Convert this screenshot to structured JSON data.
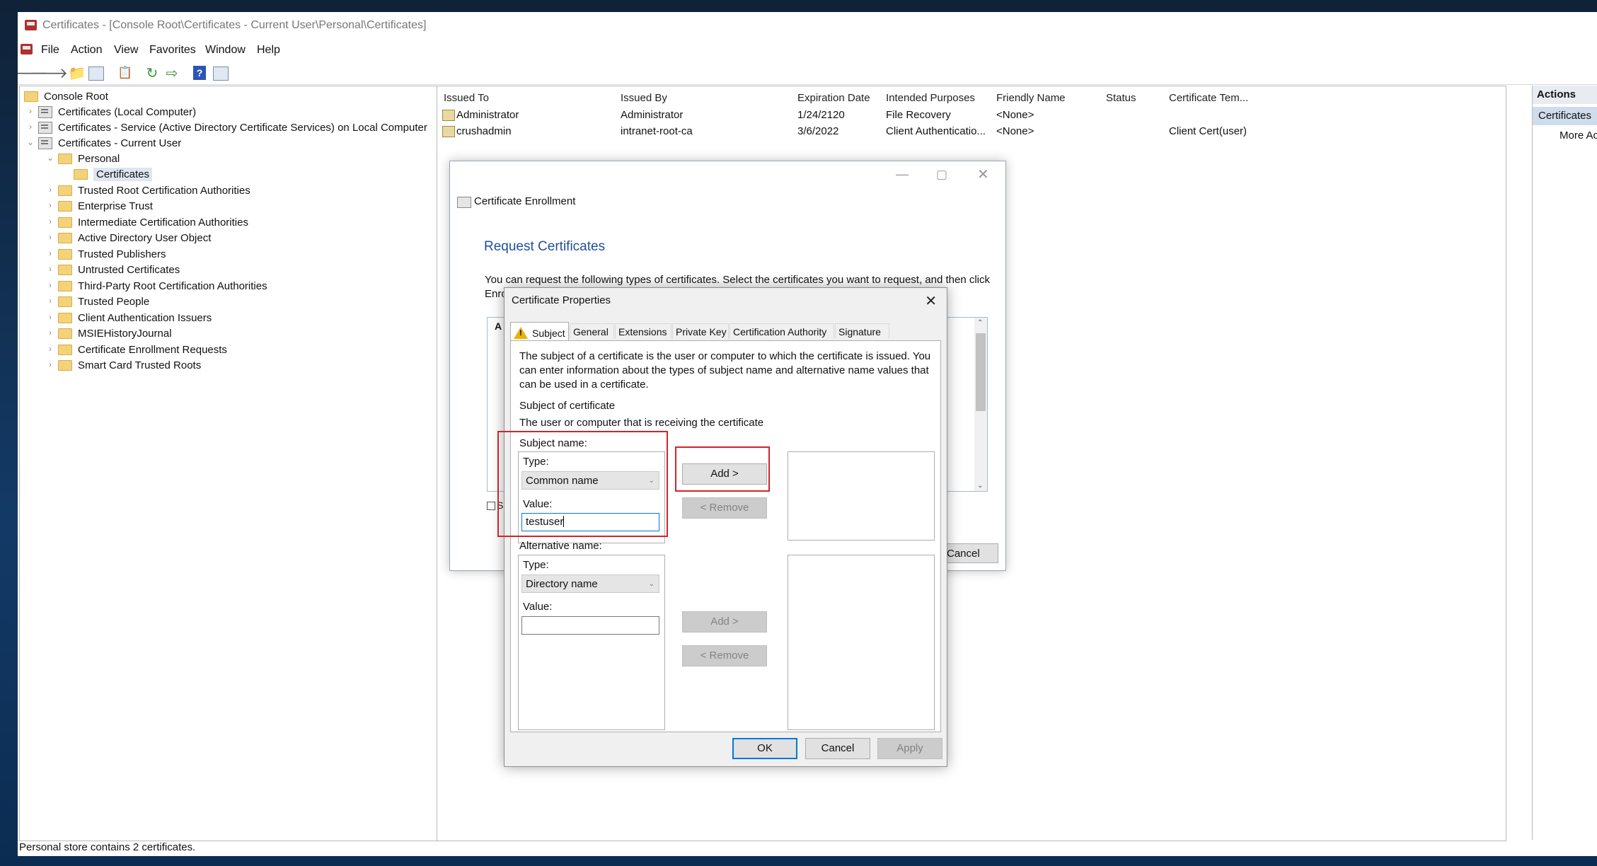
{
  "window": {
    "title": "Certificates - [Console Root\\Certificates - Current User\\Personal\\Certificates]"
  },
  "menu": [
    "File",
    "Action",
    "View",
    "Favorites",
    "Window",
    "Help"
  ],
  "toolbar_icons": [
    "back-arrow-icon",
    "forward-arrow-icon",
    "up-folder-icon",
    "show-hide-tree-icon",
    "clipboard-icon",
    "refresh-icon",
    "export-list-icon",
    "help-icon",
    "properties-icon"
  ],
  "tree": {
    "root": "Console Root",
    "local_computer": "Certificates (Local Computer)",
    "service": "Certificates - Service (Active Directory Certificate Services) on Local Computer",
    "current_user": "Certificates - Current User",
    "personal": "Personal",
    "certificates": "Certificates",
    "stores": [
      "Trusted Root Certification Authorities",
      "Enterprise Trust",
      "Intermediate Certification Authorities",
      "Active Directory User Object",
      "Trusted Publishers",
      "Untrusted Certificates",
      "Third-Party Root Certification Authorities",
      "Trusted People",
      "Client Authentication Issuers",
      "MSIEHistoryJournal",
      "Certificate Enrollment Requests",
      "Smart Card Trusted Roots"
    ]
  },
  "list": {
    "columns": [
      "Issued To",
      "Issued By",
      "Expiration Date",
      "Intended Purposes",
      "Friendly Name",
      "Status",
      "Certificate Tem..."
    ],
    "rows": [
      [
        "Administrator",
        "Administrator",
        "1/24/2120",
        "File Recovery",
        "<None>",
        "",
        ""
      ],
      [
        "crushadmin",
        "intranet-root-ca",
        "3/6/2022",
        "Client Authenticatio...",
        "<None>",
        "",
        "Client Cert(user)"
      ]
    ]
  },
  "actions": {
    "header": "Actions",
    "section": "Certificates",
    "more": "More Ac"
  },
  "statusbar": "Personal store contains 2 certificates.",
  "enrollment": {
    "title": "Certificate Enrollment",
    "heading": "Request Certificates",
    "text": "You can request the following types of certificates. Select the certificates you want to request, and then click",
    "text2": "Enro",
    "list_header": "A",
    "checkbox_label": "Sl",
    "cancel": "Cancel"
  },
  "properties": {
    "title": "Certificate Properties",
    "tabs": [
      "Subject",
      "General",
      "Extensions",
      "Private Key",
      "Certification Authority",
      "Signature"
    ],
    "description": "The subject of a certificate is the user or computer to which the certificate is issued. You can enter information about the types of subject name and alternative name values that can be used in a certificate.",
    "subject_heading": "Subject of certificate",
    "subject_sub": "The user or computer that is receiving the certificate",
    "subject_name_label": "Subject name:",
    "type_label": "Type:",
    "subject_type": "Common name",
    "value_label": "Value:",
    "subject_value": "testuser",
    "alt_name_label": "Alternative name:",
    "alt_type": "Directory name",
    "alt_value": "",
    "add": "Add >",
    "remove": "< Remove",
    "ok": "OK",
    "cancel": "Cancel",
    "apply": "Apply"
  }
}
